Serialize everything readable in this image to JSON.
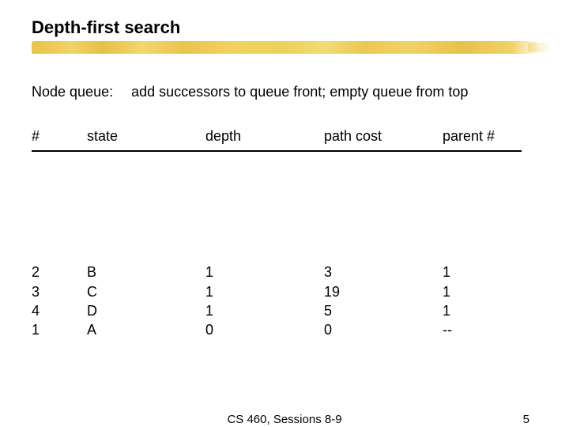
{
  "title": "Depth-first search",
  "queue_label": "Node queue:",
  "queue_desc": "add successors to queue front; empty queue from top",
  "columns": {
    "num": "#",
    "state": "state",
    "depth": "depth",
    "path_cost": "path cost",
    "parent": "parent #"
  },
  "rows": [
    {
      "num": "2",
      "state": "B",
      "depth": "1",
      "path_cost": "3",
      "parent": "1"
    },
    {
      "num": "3",
      "state": "C",
      "depth": "1",
      "path_cost": "19",
      "parent": "1"
    },
    {
      "num": "4",
      "state": "D",
      "depth": "1",
      "path_cost": "5",
      "parent": "1"
    },
    {
      "num": "1",
      "state": "A",
      "depth": "0",
      "path_cost": "0",
      "parent": "--"
    }
  ],
  "footer_center": "CS 460,  Sessions 8-9",
  "page_number": "5"
}
